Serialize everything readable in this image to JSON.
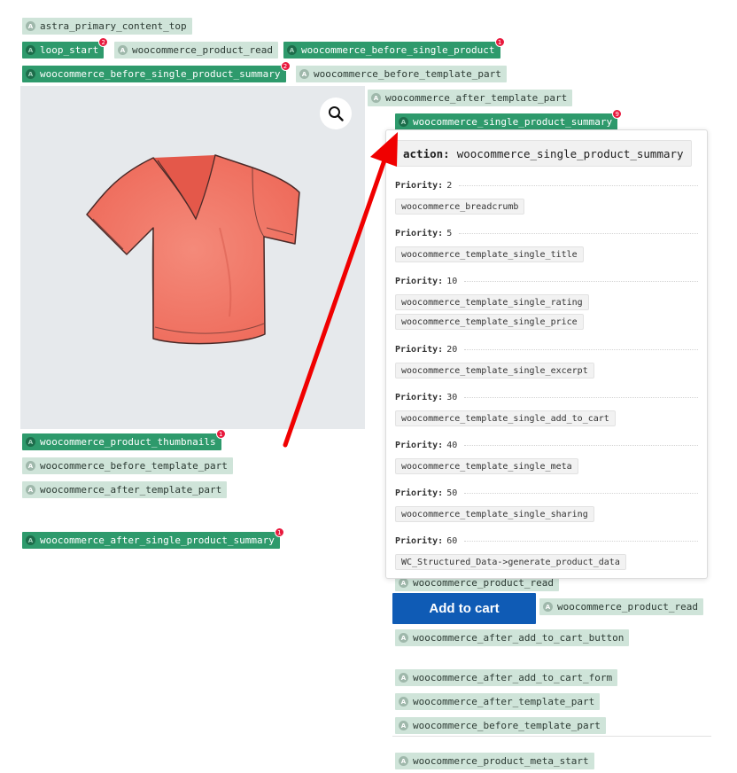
{
  "tags": {
    "astra_primary_content_top": "astra_primary_content_top",
    "loop_start": "loop_start",
    "loop_start_badge": "2",
    "product_read_top": "woocommerce_product_read",
    "before_single_product": "woocommerce_before_single_product",
    "before_single_product_badge": "1",
    "before_single_product_summary": "woocommerce_before_single_product_summary",
    "before_single_product_summary_badge": "2",
    "before_template_part_top": "woocommerce_before_template_part",
    "after_template_part_top": "woocommerce_after_template_part",
    "single_product_summary": "woocommerce_single_product_summary",
    "single_product_summary_badge": "9",
    "product_thumbnails": "woocommerce_product_thumbnails",
    "product_thumbnails_badge": "1",
    "before_template_part_left": "woocommerce_before_template_part",
    "after_template_part_left": "woocommerce_after_template_part",
    "after_single_product_summary": "woocommerce_after_single_product_summary",
    "after_single_product_summary_badge": "1",
    "product_read_mid": "woocommerce_product_read",
    "product_read_cart": "woocommerce_product_read",
    "after_add_to_cart_button": "woocommerce_after_add_to_cart_button",
    "after_add_to_cart_form": "woocommerce_after_add_to_cart_form",
    "after_template_part_right": "woocommerce_after_template_part",
    "before_template_part_right": "woocommerce_before_template_part",
    "product_meta_start": "woocommerce_product_meta_start"
  },
  "icon_letter": "A",
  "popover": {
    "label": "action:",
    "hook": "woocommerce_single_product_summary",
    "priority_label": "Priority:",
    "groups": [
      {
        "priority": "2",
        "callbacks": [
          "woocommerce_breadcrumb"
        ]
      },
      {
        "priority": "5",
        "callbacks": [
          "woocommerce_template_single_title"
        ]
      },
      {
        "priority": "10",
        "callbacks": [
          "woocommerce_template_single_rating",
          "woocommerce_template_single_price"
        ]
      },
      {
        "priority": "20",
        "callbacks": [
          "woocommerce_template_single_excerpt"
        ]
      },
      {
        "priority": "30",
        "callbacks": [
          "woocommerce_template_single_add_to_cart"
        ]
      },
      {
        "priority": "40",
        "callbacks": [
          "woocommerce_template_single_meta"
        ]
      },
      {
        "priority": "50",
        "callbacks": [
          "woocommerce_template_single_sharing"
        ]
      },
      {
        "priority": "60",
        "callbacks": [
          "WC_Structured_Data->generate_product_data"
        ]
      }
    ]
  },
  "cart": {
    "label": "Add to cart"
  },
  "icons": {
    "zoom": "magnifier-icon",
    "tag": "a-circle-icon",
    "arrow": "red-pointer-arrow"
  },
  "colors": {
    "tag_light": "#cfe4d9",
    "tag_dark": "#2e9a6c",
    "badge": "#e8193d",
    "cart_button": "#0f5bb5",
    "arrow": "#f00000",
    "tshirt": "#f27a6a"
  }
}
